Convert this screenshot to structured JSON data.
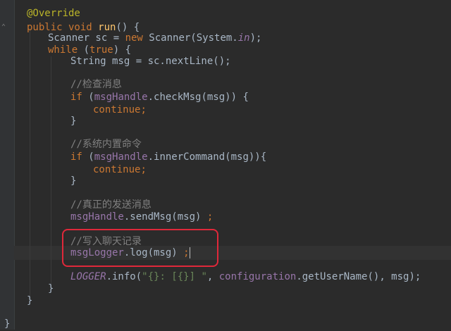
{
  "code": {
    "l1": {
      "annotation": "@Override"
    },
    "l2": {
      "kw": "public void ",
      "method": "run",
      "rest": "() {"
    },
    "l3": {
      "p1": "Scanner sc = ",
      "kw": "new ",
      "p2": "Scanner(System.",
      "field": "in",
      "p3": ");"
    },
    "l4": {
      "kw1": "while ",
      "p1": "(",
      "kw2": "true",
      "p2": ") {"
    },
    "l5": {
      "text": "String msg = sc.nextLine();"
    },
    "l7": {
      "comment": "//检查消息"
    },
    "l8": {
      "kw": "if ",
      "p1": "(",
      "field": "msgHandle",
      "p2": ".checkMsg(msg)) {"
    },
    "l9": {
      "kw": "continue",
      "p": ";"
    },
    "l10": {
      "text": "}"
    },
    "l12": {
      "comment": "//系统内置命令"
    },
    "l13": {
      "kw": "if ",
      "p1": "(",
      "field": "msgHandle",
      "p2": ".innerCommand(msg)){"
    },
    "l14": {
      "kw": "continue",
      "p": ";"
    },
    "l15": {
      "text": "}"
    },
    "l17": {
      "comment": "//真正的发送消息"
    },
    "l18": {
      "field": "msgHandle",
      "p1": ".sendMsg(msg) ",
      "semi": ";"
    },
    "l20": {
      "comment": "//写入聊天记录"
    },
    "l21": {
      "field": "msgLogger",
      "p1": ".log(msg) ",
      "semi": ";"
    },
    "l23": {
      "logger": "LOGGER",
      "p1": ".info(",
      "str": "\"{}: [{}] \"",
      "p2": ", ",
      "field": "configuration",
      "p3": ".getUserName(), msg);"
    },
    "l24": {
      "text": "}"
    },
    "l25": {
      "text": "}"
    },
    "l27": {
      "text": "}"
    }
  },
  "colors": {
    "background": "#2b2b2b",
    "keyword": "#cc7832",
    "annotation": "#bbb529",
    "field": "#9876aa",
    "method": "#ffc66d",
    "comment": "#808080",
    "string": "#6a8759",
    "highlight_box": "#e0283a"
  }
}
